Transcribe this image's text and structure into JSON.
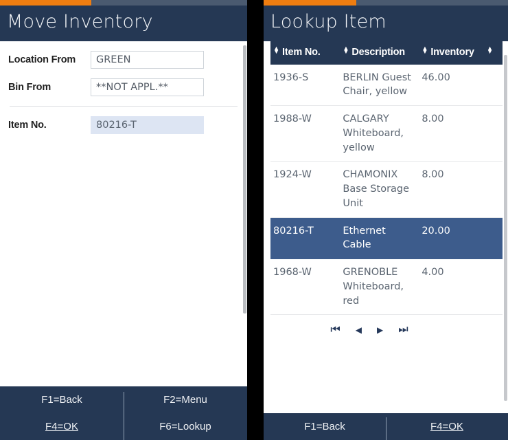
{
  "colors": {
    "header_bg": "#253854",
    "accent_orange": "#ef7d10",
    "progress_track": "#4a5a70",
    "row_selected": "#3d5c8c",
    "field_highlight": "#dde5f3"
  },
  "left_panel": {
    "progress_percent": 37,
    "title": "Move Inventory",
    "fields": [
      {
        "label": "Location From",
        "value": "GREEN",
        "highlighted": false
      },
      {
        "label": "Bin From",
        "value": "**NOT APPL.**",
        "highlighted": false
      },
      {
        "label": "Item No.",
        "value": "80216-T",
        "highlighted": true
      }
    ],
    "footer": [
      {
        "label": "F1=Back",
        "focused": false
      },
      {
        "label": "F2=Menu",
        "focused": false
      },
      {
        "label": "F4=OK",
        "focused": true
      },
      {
        "label": "F6=Lookup",
        "focused": false
      }
    ]
  },
  "right_panel": {
    "progress_percent": 38,
    "title": "Lookup Item",
    "table": {
      "columns": [
        "Item No.",
        "Description",
        "Inventory",
        ""
      ],
      "rows": [
        {
          "item_no": "1936-S",
          "description": "BERLIN Guest Chair, yellow",
          "inventory": "46.00",
          "selected": false
        },
        {
          "item_no": "1988-W",
          "description": "CALGARY Whiteboard, yellow",
          "inventory": "8.00",
          "selected": false
        },
        {
          "item_no": "1924-W",
          "description": "CHAMONIX Base Storage Unit",
          "inventory": "8.00",
          "selected": false
        },
        {
          "item_no": "80216-T",
          "description": "Ethernet Cable",
          "inventory": "20.00",
          "selected": true
        },
        {
          "item_no": "1968-W",
          "description": "GRENOBLE Whiteboard, red",
          "inventory": "4.00",
          "selected": false
        }
      ]
    },
    "pagination": [
      {
        "name": "first-page-button",
        "glyph": "⏮"
      },
      {
        "name": "previous-page-button",
        "glyph": "◀"
      },
      {
        "name": "next-page-button",
        "glyph": "▶"
      },
      {
        "name": "last-page-button",
        "glyph": "⏭"
      }
    ],
    "footer": [
      {
        "label": "F1=Back",
        "focused": false
      },
      {
        "label": "F4=OK",
        "focused": true
      }
    ]
  }
}
